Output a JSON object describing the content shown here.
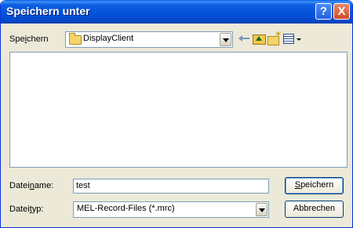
{
  "dialog": {
    "title": "Speichern unter",
    "help_label": "?",
    "close_label": "X"
  },
  "location": {
    "label_pre": "Spe",
    "label_key": "i",
    "label_post": "chern",
    "folder": "DisplayClient"
  },
  "filename": {
    "label_pre": "Datei",
    "label_key": "n",
    "label_post": "ame:",
    "value": "test"
  },
  "filetype": {
    "label_pre": "Datei",
    "label_key": "t",
    "label_post": "yp:",
    "selected": "MEL-Record-Files (*.mrc)"
  },
  "buttons": {
    "save_key": "S",
    "save_rest": "peichern",
    "cancel": "Abbrechen"
  },
  "toolbar_icons": [
    "back-arrow-icon",
    "up-folder-icon",
    "new-folder-icon",
    "view-menu-icon"
  ]
}
